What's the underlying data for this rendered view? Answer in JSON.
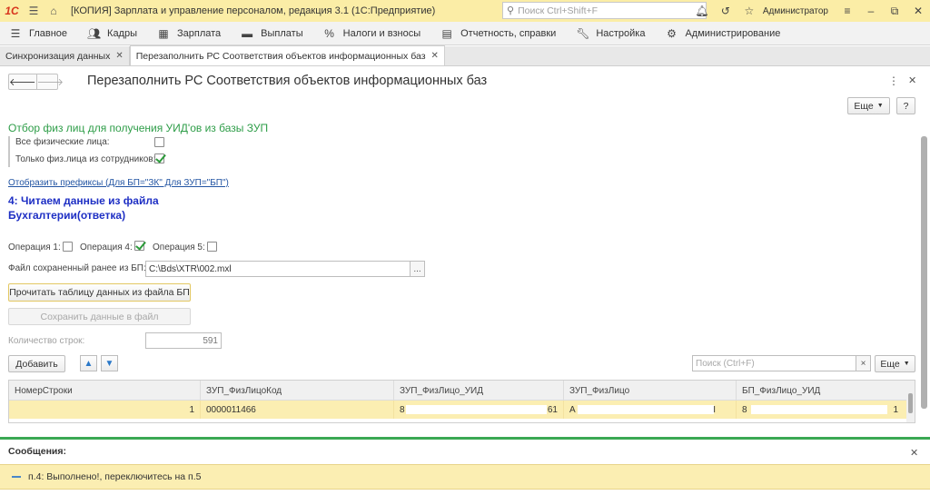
{
  "titlebar": {
    "logo": "1С",
    "app_title": "[КОПИЯ] Зарплата и управление персоналом, редакция 3.1  (1С:Предприятие)",
    "search_placeholder": "Поиск Ctrl+Shift+F",
    "user": "Администратор"
  },
  "main_menu": [
    {
      "label": "Главное",
      "icon": "menu-icon"
    },
    {
      "label": "Кадры",
      "icon": "people-icon"
    },
    {
      "label": "Зарплата",
      "icon": "calculator-icon"
    },
    {
      "label": "Выплаты",
      "icon": "wallet-icon"
    },
    {
      "label": "Налоги и взносы",
      "icon": "percent-icon"
    },
    {
      "label": "Отчетность, справки",
      "icon": "report-icon"
    },
    {
      "label": "Настройка",
      "icon": "wrench-icon"
    },
    {
      "label": "Администрирование",
      "icon": "gear-icon"
    }
  ],
  "tabs": [
    {
      "label": "Синхронизация данных",
      "active": false
    },
    {
      "label": "Перезаполнить РС Соответствия объектов информационных баз",
      "active": true
    }
  ],
  "form": {
    "title": "Перезаполнить РС Соответствия объектов информационных баз",
    "more_label": "Еще",
    "help_label": "?"
  },
  "filter": {
    "title": "Отбор физ лиц для получения УИД'ов из базы ЗУП",
    "all_persons_label": "Все физические лица:",
    "all_persons_checked": false,
    "employees_only_label": "Только физ.лица из сотрудников:",
    "employees_only_checked": true
  },
  "prefix_link": "Отобразить префиксы (Для БП=\"ЗК\" Для ЗУП=\"БП\")",
  "step_title": "4: Читаем данные из файла Бухгалтерии(ответка)",
  "operations": {
    "op1_label": "Операция 1:",
    "op1_checked": false,
    "op4_label": "Операция 4:",
    "op4_checked": true,
    "op5_label": "Операция 5:",
    "op5_checked": false
  },
  "file": {
    "label": "Файл сохраненный ранее из БП:",
    "value": "C:\\Bds\\XTR\\002.mxl",
    "browse": "..."
  },
  "buttons": {
    "read_table": "Прочитать таблицу данных из файла БП",
    "save_data": "Сохранить данные в файл",
    "add": "Добавить"
  },
  "row_count": {
    "label": "Количество строк:",
    "value": "591"
  },
  "table_toolbar": {
    "search_placeholder": "Поиск (Ctrl+F)",
    "clear": "×",
    "more_label": "Еще"
  },
  "table": {
    "columns": [
      "НомерСтроки",
      "ЗУП_ФизЛицоКод",
      "ЗУП_ФизЛицо_УИД",
      "ЗУП_ФизЛицо",
      "БП_ФизЛицо_УИД"
    ],
    "rows": [
      [
        "1",
        "0000011466",
        "8",
        "А",
        "8"
      ]
    ],
    "row_tails": [
      "",
      "",
      "61",
      "I",
      "1"
    ]
  },
  "messages": {
    "title": "Сообщения:",
    "items": [
      "п.4: Выполнено!, переключитесь на п.5"
    ]
  }
}
